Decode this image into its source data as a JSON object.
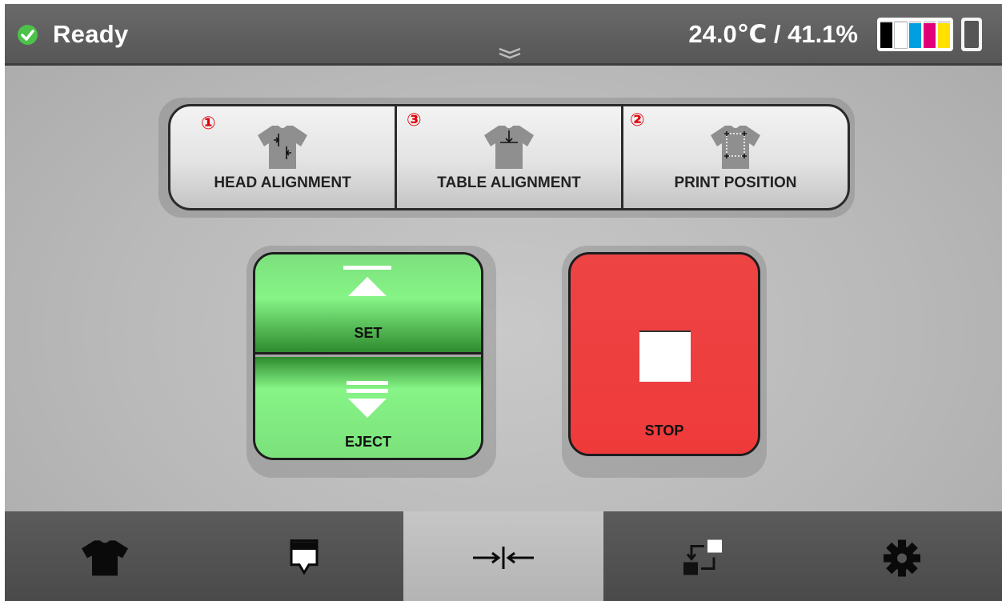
{
  "status": {
    "icon": "check-circle-icon",
    "text": "Ready"
  },
  "header": {
    "expand_icon": "double-chevron-down-icon",
    "environment": "24.0℃ / 41.1%"
  },
  "ink_levels": [
    {
      "color": "#000000",
      "level": 0.95
    },
    {
      "color": "#ffffff",
      "level": 0.95
    },
    {
      "color": "#00a0e0",
      "level": 0.9
    },
    {
      "color": "#e2007a",
      "level": 0.9
    },
    {
      "color": "#ffe000",
      "level": 0.9
    }
  ],
  "waste_tank": {
    "icon": "waste-tank-icon"
  },
  "alignment": [
    {
      "number": "①",
      "label": "HEAD ALIGNMENT",
      "icon": "tshirt-head-alignment-icon"
    },
    {
      "number": "③",
      "label": "TABLE ALIGNMENT",
      "icon": "tshirt-table-alignment-icon"
    },
    {
      "number": "②",
      "label": "PRINT POSITION",
      "icon": "tshirt-print-position-icon"
    }
  ],
  "controls": {
    "set_label": "SET",
    "eject_label": "EJECT",
    "stop_label": "STOP"
  },
  "nav": [
    {
      "icon": "tshirt-icon",
      "active": false
    },
    {
      "icon": "ink-drop-icon",
      "active": false
    },
    {
      "icon": "alignment-arrows-icon",
      "active": true
    },
    {
      "icon": "transfer-icon",
      "active": false
    },
    {
      "icon": "gear-icon",
      "active": false
    }
  ],
  "colors": {
    "accent_green": "#4cc24a",
    "set_green": "#86f486",
    "stop_red": "#ee4444",
    "number_red": "#e0000a"
  }
}
